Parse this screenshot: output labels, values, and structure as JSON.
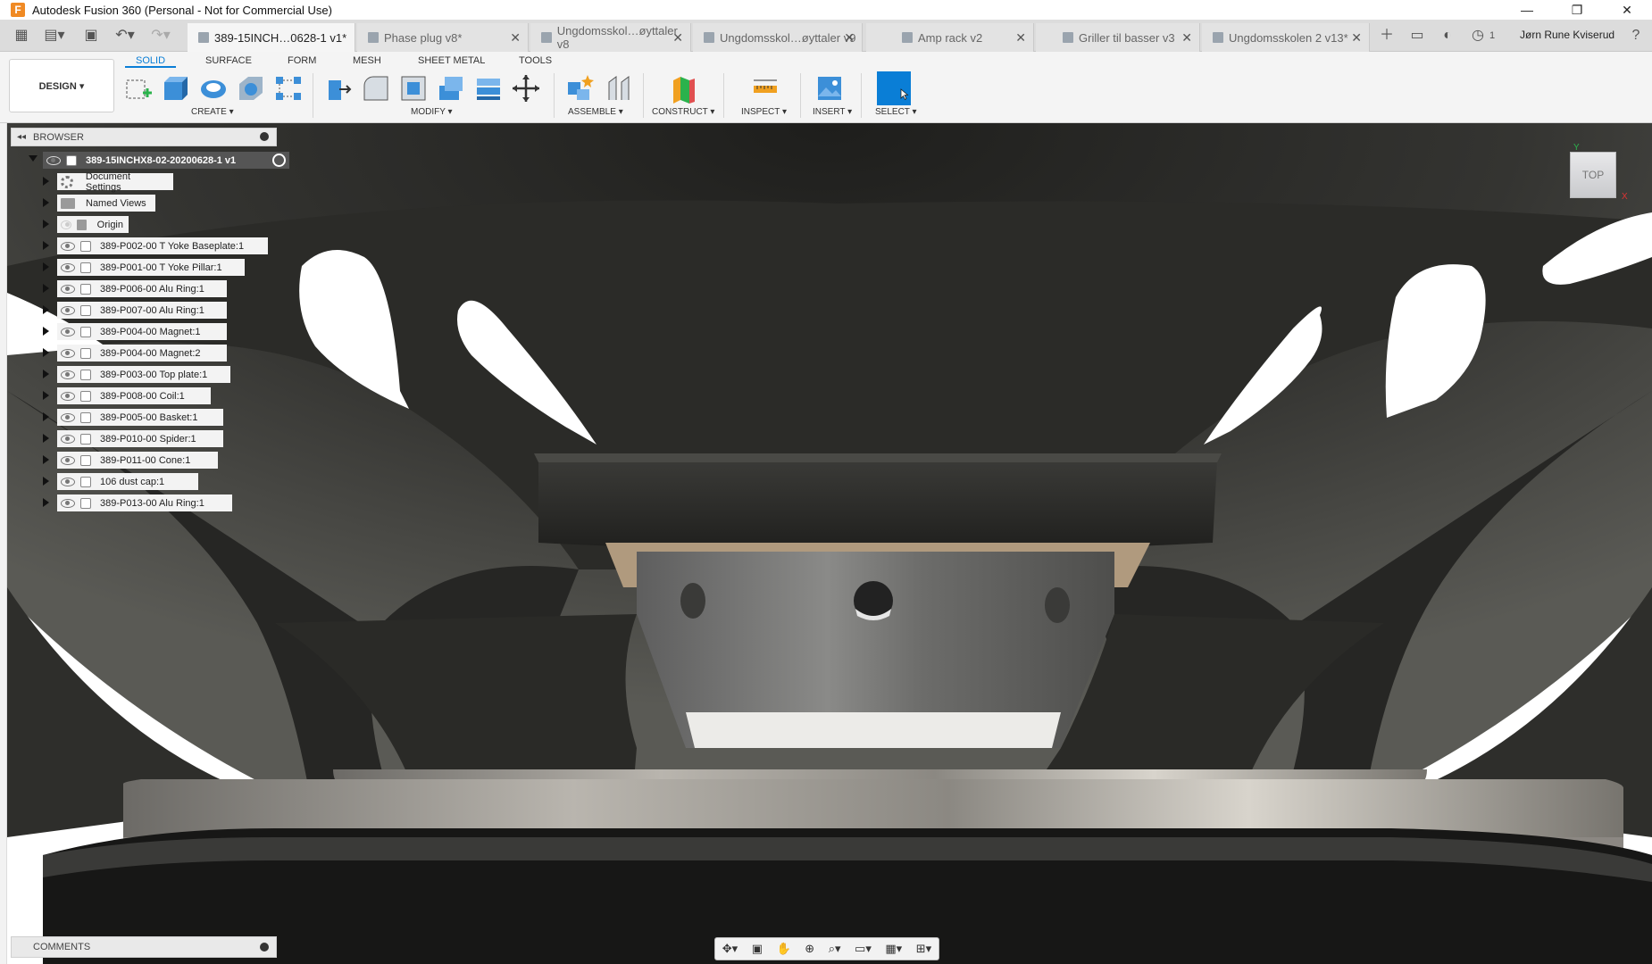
{
  "window": {
    "title": "Autodesk Fusion 360 (Personal - Not for Commercial Use)",
    "logo_letter": "F",
    "minimize": "—",
    "maximize": "❐",
    "close": "✕"
  },
  "tabs": [
    {
      "label": "389-15INCH…0628-1 v1*",
      "active": true
    },
    {
      "label": "Phase plug v8*"
    },
    {
      "label": "Ungdomsskol…øyttaler v8"
    },
    {
      "label": "Ungdomsskol…øyttaler v9"
    },
    {
      "label": "Amp rack v2"
    },
    {
      "label": "Griller til basser v3"
    },
    {
      "label": "Ungdomsskolen 2 v13*"
    }
  ],
  "topbar": {
    "notifications_count": "1",
    "user_name": "Jørn Rune Kviserud",
    "help": "?"
  },
  "toolbar": {
    "design_label": "DESIGN ▾",
    "ribbon_tabs": [
      "SOLID",
      "SURFACE",
      "FORM",
      "MESH",
      "SHEET METAL",
      "TOOLS"
    ],
    "groups": {
      "create": "CREATE ▾",
      "modify": "MODIFY ▾",
      "assemble": "ASSEMBLE ▾",
      "construct": "CONSTRUCT ▾",
      "inspect": "INSPECT ▾",
      "insert": "INSERT ▾",
      "select": "SELECT ▾"
    }
  },
  "browser": {
    "title": "BROWSER",
    "root": "389-15INCHX8-02-20200628-1 v1",
    "items": [
      {
        "label": "Document Settings",
        "type": "settings"
      },
      {
        "label": "Named Views",
        "type": "folder"
      },
      {
        "label": "Origin",
        "type": "folder",
        "hidden": true
      },
      {
        "label": "389-P002-00 T Yoke Baseplate:1",
        "type": "component"
      },
      {
        "label": "389-P001-00 T Yoke Pillar:1",
        "type": "component"
      },
      {
        "label": "389-P006-00 Alu Ring:1",
        "type": "component"
      },
      {
        "label": "389-P007-00 Alu Ring:1",
        "type": "component"
      },
      {
        "label": "389-P004-00 Magnet:1",
        "type": "component"
      },
      {
        "label": "389-P004-00 Magnet:2",
        "type": "component"
      },
      {
        "label": "389-P003-00 Top plate:1",
        "type": "component"
      },
      {
        "label": "389-P008-00 Coil:1",
        "type": "component"
      },
      {
        "label": "389-P005-00 Basket:1",
        "type": "component"
      },
      {
        "label": "389-P010-00 Spider:1",
        "type": "component"
      },
      {
        "label": "389-P011-00 Cone:1",
        "type": "component"
      },
      {
        "label": "106 dust cap:1",
        "type": "component"
      },
      {
        "label": "389-P013-00 Alu Ring:1",
        "type": "component"
      }
    ]
  },
  "comments": {
    "title": "COMMENTS"
  },
  "viewcube": {
    "face": "TOP",
    "axis_y": "Y",
    "axis_x": "X"
  },
  "colors": {
    "accent": "#0a7ed6",
    "basket": "#2e2e2b",
    "metal": "#b8b4ad"
  }
}
